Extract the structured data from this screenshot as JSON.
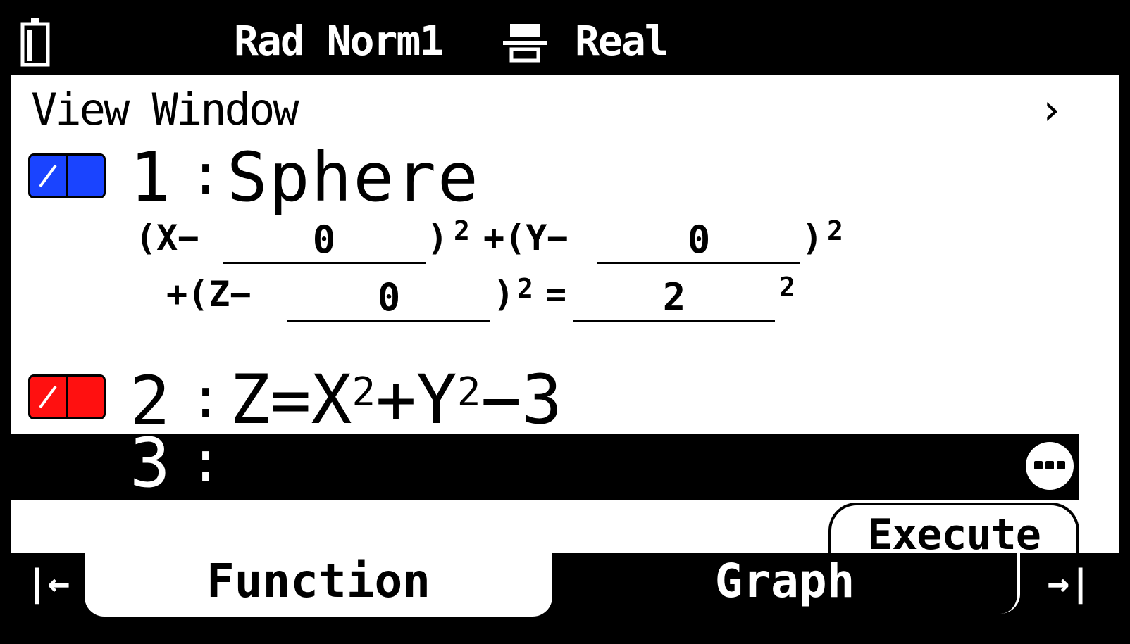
{
  "status_bar": {
    "mode": "Rad Norm1",
    "complex": "Real",
    "battery_icon": "battery-icon",
    "format_icon": "fraction-format-icon"
  },
  "header": {
    "title": "View Window",
    "next_icon": "chevron-right-icon"
  },
  "functions": [
    {
      "index": "1",
      "colon": ":",
      "color": "#1a44ff",
      "title": "Sphere",
      "equation": {
        "p1": "(X−",
        "x_center": "0",
        "p2": ")",
        "exp1": "2",
        "p3": "+(Y−",
        "y_center": "0",
        "p4": ")",
        "exp2": "2",
        "p5": "+(Z−",
        "z_center": "0",
        "p6": ")",
        "exp3": "2",
        "p7": "=",
        "radius": "2",
        "exp4": "2"
      }
    },
    {
      "index": "2",
      "colon": ":",
      "color": "#ff1010",
      "expr_a": "Z=X",
      "exp_a": "2",
      "expr_b": "+Y",
      "exp_b": "2",
      "expr_c": "−3"
    },
    {
      "index": "3",
      "colon": ":"
    }
  ],
  "execute_label": "Execute",
  "tabs": {
    "left_icon": "|←",
    "function": "Function",
    "graph": "Graph",
    "right_icon": "→|"
  }
}
